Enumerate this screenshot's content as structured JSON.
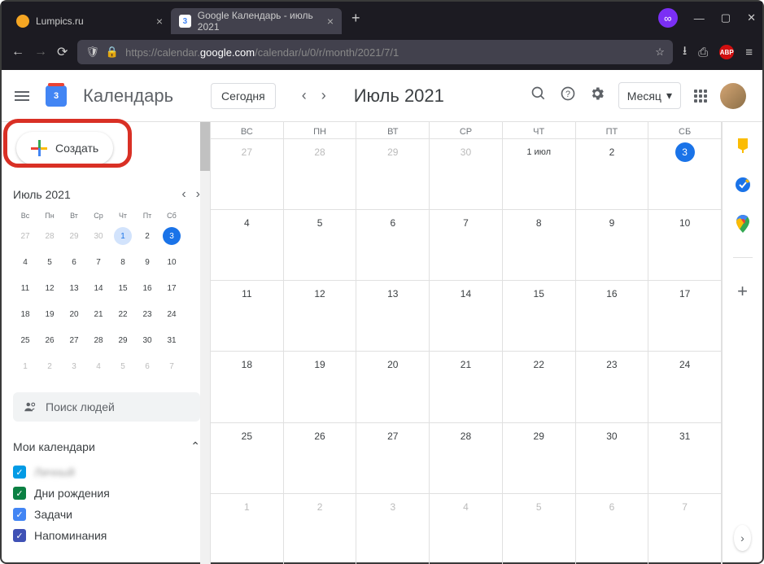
{
  "browser": {
    "tabs": [
      {
        "label": "Lumpics.ru",
        "active": false,
        "icon_color": "#f5a623"
      },
      {
        "label": "Google Календарь - июль 2021",
        "active": true,
        "icon_bg": "#fff",
        "icon_text": "3"
      }
    ],
    "url_prefix": "https://calendar.",
    "url_domain": "google.com",
    "url_path": "/calendar/u/0/r/month/2021/7/1"
  },
  "header": {
    "app_name": "Календарь",
    "logo_day": "3",
    "today_label": "Сегодня",
    "month_label": "Июль 2021",
    "view_label": "Месяц"
  },
  "create": {
    "label": "Создать"
  },
  "mini_calendar": {
    "title": "Июль 2021",
    "dow": [
      "Вс",
      "Пн",
      "Вт",
      "Ср",
      "Чт",
      "Пт",
      "Сб"
    ],
    "rows": [
      [
        {
          "n": "27",
          "o": true
        },
        {
          "n": "28",
          "o": true
        },
        {
          "n": "29",
          "o": true
        },
        {
          "n": "30",
          "o": true
        },
        {
          "n": "1",
          "today": true
        },
        {
          "n": "2"
        },
        {
          "n": "3",
          "sel": true
        }
      ],
      [
        {
          "n": "4"
        },
        {
          "n": "5"
        },
        {
          "n": "6"
        },
        {
          "n": "7"
        },
        {
          "n": "8"
        },
        {
          "n": "9"
        },
        {
          "n": "10"
        }
      ],
      [
        {
          "n": "11"
        },
        {
          "n": "12"
        },
        {
          "n": "13"
        },
        {
          "n": "14"
        },
        {
          "n": "15"
        },
        {
          "n": "16"
        },
        {
          "n": "17"
        }
      ],
      [
        {
          "n": "18"
        },
        {
          "n": "19"
        },
        {
          "n": "20"
        },
        {
          "n": "21"
        },
        {
          "n": "22"
        },
        {
          "n": "23"
        },
        {
          "n": "24"
        }
      ],
      [
        {
          "n": "25"
        },
        {
          "n": "26"
        },
        {
          "n": "27"
        },
        {
          "n": "28"
        },
        {
          "n": "29"
        },
        {
          "n": "30"
        },
        {
          "n": "31"
        }
      ],
      [
        {
          "n": "1",
          "o": true
        },
        {
          "n": "2",
          "o": true
        },
        {
          "n": "3",
          "o": true
        },
        {
          "n": "4",
          "o": true
        },
        {
          "n": "5",
          "o": true
        },
        {
          "n": "6",
          "o": true
        },
        {
          "n": "7",
          "o": true
        }
      ]
    ]
  },
  "people_search": {
    "placeholder": "Поиск людей"
  },
  "my_calendars": {
    "title": "Мои календари",
    "items": [
      {
        "label": "Личный",
        "color": "#039be5",
        "blurred": true
      },
      {
        "label": "Дни рождения",
        "color": "#0b8043"
      },
      {
        "label": "Задачи",
        "color": "#4285f4"
      },
      {
        "label": "Напоминания",
        "color": "#3f51b5"
      }
    ]
  },
  "grid": {
    "dow": [
      "ВС",
      "ПН",
      "ВТ",
      "СР",
      "ЧТ",
      "ПТ",
      "СБ"
    ],
    "weeks": [
      [
        {
          "n": "27",
          "o": true
        },
        {
          "n": "28",
          "o": true
        },
        {
          "n": "29",
          "o": true
        },
        {
          "n": "30",
          "o": true
        },
        {
          "n": "1 июл",
          "first": true
        },
        {
          "n": "2"
        },
        {
          "n": "3",
          "sel": true
        }
      ],
      [
        {
          "n": "4"
        },
        {
          "n": "5"
        },
        {
          "n": "6"
        },
        {
          "n": "7"
        },
        {
          "n": "8"
        },
        {
          "n": "9"
        },
        {
          "n": "10"
        }
      ],
      [
        {
          "n": "11"
        },
        {
          "n": "12"
        },
        {
          "n": "13"
        },
        {
          "n": "14"
        },
        {
          "n": "15"
        },
        {
          "n": "16"
        },
        {
          "n": "17"
        }
      ],
      [
        {
          "n": "18"
        },
        {
          "n": "19"
        },
        {
          "n": "20"
        },
        {
          "n": "21"
        },
        {
          "n": "22"
        },
        {
          "n": "23"
        },
        {
          "n": "24"
        }
      ],
      [
        {
          "n": "25"
        },
        {
          "n": "26"
        },
        {
          "n": "27"
        },
        {
          "n": "28"
        },
        {
          "n": "29"
        },
        {
          "n": "30"
        },
        {
          "n": "31"
        }
      ],
      [
        {
          "n": "1",
          "o": true
        },
        {
          "n": "2",
          "o": true
        },
        {
          "n": "3",
          "o": true
        },
        {
          "n": "4",
          "o": true
        },
        {
          "n": "5",
          "o": true
        },
        {
          "n": "6",
          "o": true
        },
        {
          "n": "7",
          "o": true
        }
      ]
    ]
  },
  "side_panel": {
    "keep_color": "#fbbc04",
    "tasks_color": "#1a73e8",
    "maps_pin": "#ea4335"
  }
}
